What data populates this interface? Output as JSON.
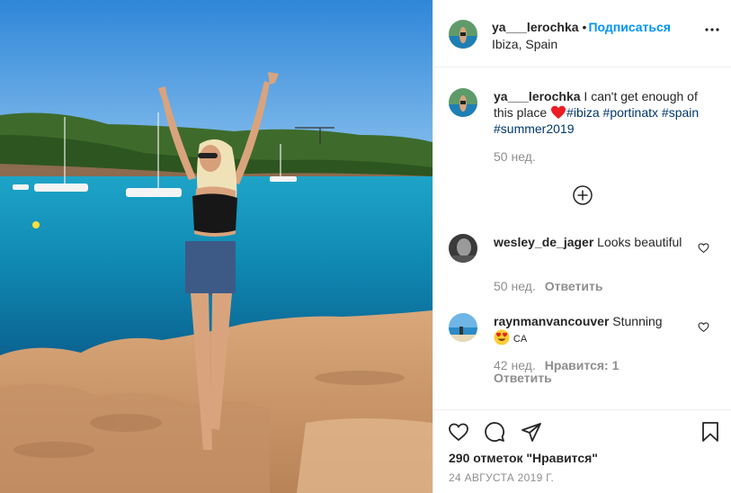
{
  "post": {
    "username": "ya___lerochka",
    "follow_label": "Подписаться",
    "location": "Ibiza, Spain",
    "caption_text": " I can't get enough of this place ",
    "hashtags": [
      "#ibiza",
      "#portinatx",
      "#spain",
      "#summer2019"
    ],
    "caption_time": "50 нед.",
    "likes_text": "290 отметок \"Нравится\"",
    "date": "24 АВГУСТА 2019 Г."
  },
  "comments": [
    {
      "username": "wesley_de_jager",
      "text": " Looks beautiful",
      "time": "50 нед.",
      "reply": "Ответить"
    },
    {
      "username": "raynmanvancouver",
      "text": " Stunning",
      "suffix": "CA",
      "time": "42 нед.",
      "likes_label": "Нравится: 1",
      "reply": "Ответить"
    }
  ],
  "colors": {
    "accent": "#0095f6",
    "hashtag": "#00376b",
    "secondary_text": "#8e8e8e",
    "heart_emoji": "#ed1c24"
  },
  "icons": [
    "more-options-icon",
    "load-more-comments-icon",
    "comment-like-heart-icon",
    "like-heart-icon",
    "comment-icon",
    "share-icon",
    "save-bookmark-icon",
    "red-heart-emoji-icon",
    "heart-eyes-emoji-icon"
  ]
}
